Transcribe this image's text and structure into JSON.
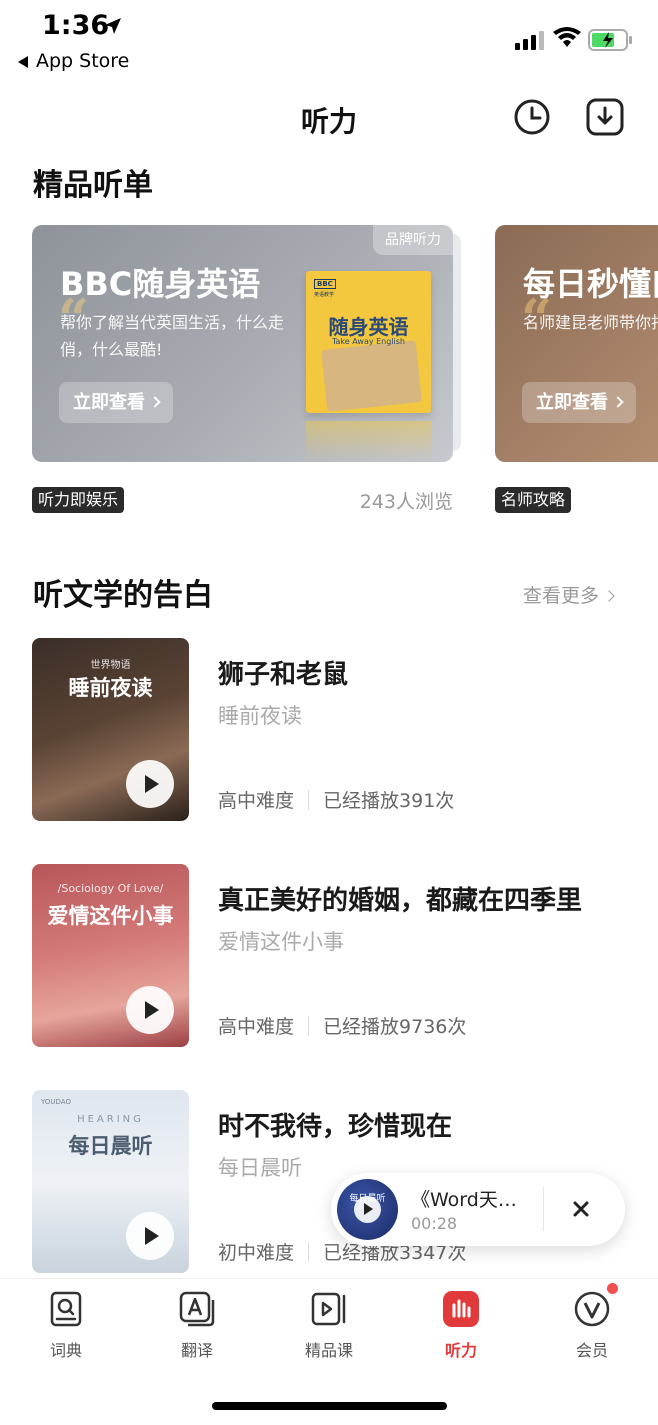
{
  "status": {
    "time": "1:36",
    "back_label": "App Store"
  },
  "header": {
    "title": "听力",
    "history_icon": "clock-icon",
    "download_icon": "download-icon"
  },
  "featured": {
    "section_title": "精品听单",
    "cards": [
      {
        "brand_tag": "品牌听力",
        "title": "BBC随身英语",
        "desc": "帮你了解当代英国生活，什么走俏，什么最酷!",
        "button": "立即查看",
        "book": {
          "logo": "BBC",
          "sub": "英语教学",
          "title": "随身英语",
          "eng": "Take Away English"
        },
        "tag": "听力即娱乐",
        "views": "243人浏览"
      },
      {
        "title": "每日秒懂口",
        "desc": "名师建昆老师带你打卡，听力上分so",
        "button": "立即查看",
        "tag": "名师攻略"
      }
    ]
  },
  "literature": {
    "section_title": "听文学的告白",
    "more_label": "查看更多",
    "items": [
      {
        "thumb_small": "世界物语",
        "thumb_caption": "睡前夜读",
        "title": "狮子和老鼠",
        "subtitle": "睡前夜读",
        "level": "高中难度",
        "plays": "已经播放391次"
      },
      {
        "thumb_small": "/Sociology Of Love/",
        "thumb_caption": "爱情这件小事",
        "title": "真正美好的婚姻，都藏在四季里",
        "subtitle": "爱情这件小事",
        "level": "高中难度",
        "plays": "已经播放9736次"
      },
      {
        "thumb_brand": "YOUDAO",
        "thumb_small": "HEARING",
        "thumb_caption": "每日晨听",
        "title": "时不我待，珍惜现在",
        "subtitle": "每日晨听",
        "level": "初中难度",
        "plays": "已经播放3347次"
      }
    ]
  },
  "player": {
    "cover_label": "每日晨听",
    "title": "《Word天…",
    "time": "00:28"
  },
  "tabs": [
    {
      "label": "词典",
      "icon": "dictionary-icon"
    },
    {
      "label": "翻译",
      "icon": "translate-icon"
    },
    {
      "label": "精品课",
      "icon": "video-course-icon"
    },
    {
      "label": "听力",
      "icon": "listening-icon",
      "active": true
    },
    {
      "label": "会员",
      "icon": "vip-icon",
      "badge": true
    }
  ],
  "colors": {
    "accent": "#e03a3a",
    "badge": "#f05050",
    "card1_bg": "#a9adb3",
    "card2_bg": "#b38e72"
  }
}
